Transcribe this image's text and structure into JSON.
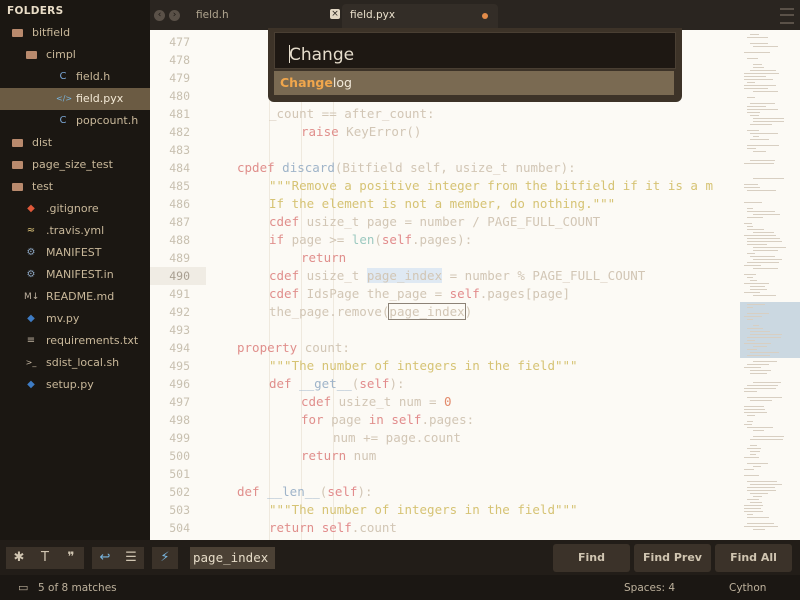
{
  "sidebar": {
    "header": "FOLDERS",
    "items": [
      {
        "label": "bitfield",
        "icon": "folder-open-icon",
        "glyph": "",
        "depth": 0
      },
      {
        "label": "cimpl",
        "icon": "folder-open-icon",
        "glyph": "",
        "depth": 1
      },
      {
        "label": "field.h",
        "icon": "c-header-file-icon",
        "glyph": "C",
        "depth": 2
      },
      {
        "label": "field.pyx",
        "icon": "code-file-icon",
        "glyph": "</>",
        "depth": 2
      },
      {
        "label": "popcount.h",
        "icon": "c-header-file-icon",
        "glyph": "C",
        "depth": 2
      },
      {
        "label": "dist",
        "icon": "folder-icon",
        "glyph": "",
        "depth": 0
      },
      {
        "label": "page_size_test",
        "icon": "folder-icon",
        "glyph": "",
        "depth": 0
      },
      {
        "label": "test",
        "icon": "folder-icon",
        "glyph": "",
        "depth": 0
      },
      {
        "label": ".gitignore",
        "icon": "git-icon",
        "glyph": "◆",
        "depth": 1
      },
      {
        "label": ".travis.yml",
        "icon": "yaml-file-icon",
        "glyph": "≈",
        "depth": 1
      },
      {
        "label": "MANIFEST",
        "icon": "gear-file-icon",
        "glyph": "⚙",
        "depth": 1
      },
      {
        "label": "MANIFEST.in",
        "icon": "gear-file-icon",
        "glyph": "⚙",
        "depth": 1
      },
      {
        "label": "README.md",
        "icon": "markdown-file-icon",
        "glyph": "M↓",
        "depth": 1
      },
      {
        "label": "mv.py",
        "icon": "python-file-icon",
        "glyph": "◆",
        "depth": 1
      },
      {
        "label": "requirements.txt",
        "icon": "text-file-icon",
        "glyph": "≡",
        "depth": 1
      },
      {
        "label": "sdist_local.sh",
        "icon": "shell-file-icon",
        "glyph": ">_",
        "depth": 1
      },
      {
        "label": "setup.py",
        "icon": "python-file-icon",
        "glyph": "◆",
        "depth": 1
      }
    ],
    "selected_index": 3
  },
  "tabs": [
    {
      "label": "field.h",
      "active": false,
      "close": "×"
    },
    {
      "label": "field.pyx",
      "active": true,
      "dirty": true
    }
  ],
  "goto_overlay": {
    "query": "Change",
    "suggestion_match": "Change",
    "suggestion_rest": "log"
  },
  "gutter": {
    "line_numbers": [
      "477",
      "478",
      "479",
      "480",
      "481",
      "482",
      "483",
      "484",
      "485",
      "486",
      "487",
      "488",
      "489",
      "490",
      "491",
      "492",
      "493",
      "494",
      "495",
      "496",
      "497",
      "498",
      "499",
      "500",
      "501",
      "502",
      "503",
      "504"
    ],
    "current_line": "490"
  },
  "code_lines": [
    {
      "indent": 0,
      "html": ""
    },
    {
      "indent": 0,
      "html": ""
    },
    {
      "indent": 0,
      "html": ""
    },
    {
      "indent": 0,
      "html": ""
    },
    {
      "indent": 1,
      "html": "_count == after_count:"
    },
    {
      "indent": 2,
      "html": "<span class=\"kw\">raise</span> KeyError()"
    },
    {
      "indent": 0,
      "html": ""
    },
    {
      "indent": 0,
      "html": "<span class=\"kw\">cpdef</span> <span class=\"fn\">discard</span>(Bitfield self, usize_t number):"
    },
    {
      "indent": 1,
      "html": "<span class=\"str\">\"\"\"Remove a positive integer from the bitfield if it is a m</span>"
    },
    {
      "indent": 1,
      "html": "<span class=\"str\">If the element is not a member, do nothing.\"\"\"</span>"
    },
    {
      "indent": 1,
      "html": "<span class=\"kw\">cdef</span> usize_t page = number / PAGE_FULL_COUNT"
    },
    {
      "indent": 1,
      "html": "<span class=\"kw\">if</span> page >= <span class=\"bi\">len</span>(<span class=\"self\">self</span>.pages):"
    },
    {
      "indent": 2,
      "html": "<span class=\"kw\">return</span>"
    },
    {
      "indent": 1,
      "html": "<span class=\"kw\">cdef</span> usize_t <span class=\"hl\">page_index</span> = number % PAGE_FULL_COUNT"
    },
    {
      "indent": 1,
      "html": "<span class=\"kw\">cdef</span> IdsPage the_page = <span class=\"self\">self</span>.pages[page]"
    },
    {
      "indent": 1,
      "html": "the_page.remove(<span class=\"box\">page_index</span>)"
    },
    {
      "indent": 0,
      "html": ""
    },
    {
      "indent": 0,
      "html": "<span class=\"kw\">property</span> count:"
    },
    {
      "indent": 1,
      "html": "<span class=\"str\">\"\"\"The number of integers in the field\"\"\"</span>"
    },
    {
      "indent": 1,
      "html": "<span class=\"kw\">def</span> <span class=\"fn\">__get__</span>(<span class=\"self\">self</span>):"
    },
    {
      "indent": 2,
      "html": "<span class=\"kw\">cdef</span> usize_t num = <span class=\"num\">0</span>"
    },
    {
      "indent": 2,
      "html": "<span class=\"kw\">for</span> page <span class=\"kw\">in</span> <span class=\"self\">self</span>.pages:"
    },
    {
      "indent": 3,
      "html": "num += page.count"
    },
    {
      "indent": 2,
      "html": "<span class=\"kw\">return</span> num"
    },
    {
      "indent": 0,
      "html": ""
    },
    {
      "indent": 0,
      "html": "<span class=\"kw\">def</span> <span class=\"fn\">__len__</span>(<span class=\"self\">self</span>):"
    },
    {
      "indent": 1,
      "html": "<span class=\"str\">\"\"\"The number of integers in the field\"\"\"</span>"
    },
    {
      "indent": 1,
      "html": "<span class=\"kw\">return</span> <span class=\"self\">self</span>.count"
    }
  ],
  "findbar": {
    "toggles": [
      {
        "name": "regex-toggle",
        "glyph": "✱"
      },
      {
        "name": "case-sensitive-toggle",
        "glyph": "T"
      },
      {
        "name": "whole-word-toggle",
        "glyph": "❞"
      },
      {
        "name": "wrap-toggle",
        "glyph": "↩"
      },
      {
        "name": "in-selection-toggle",
        "glyph": "☰"
      },
      {
        "name": "highlight-matches-toggle",
        "glyph": "⚡"
      }
    ],
    "query": "page_index",
    "find_label": "Find",
    "find_prev_label": "Find Prev",
    "find_all_label": "Find All"
  },
  "statusbar": {
    "matches": "5 of 8 matches",
    "spaces": "Spaces: 4",
    "syntax": "Cython"
  },
  "colors": {
    "accent": "#f0a64c",
    "sidebar_selected": "#6b5b43",
    "editor_bg": "#fcfaf5",
    "keyword": "#e08f8c",
    "string": "#d6c374"
  }
}
